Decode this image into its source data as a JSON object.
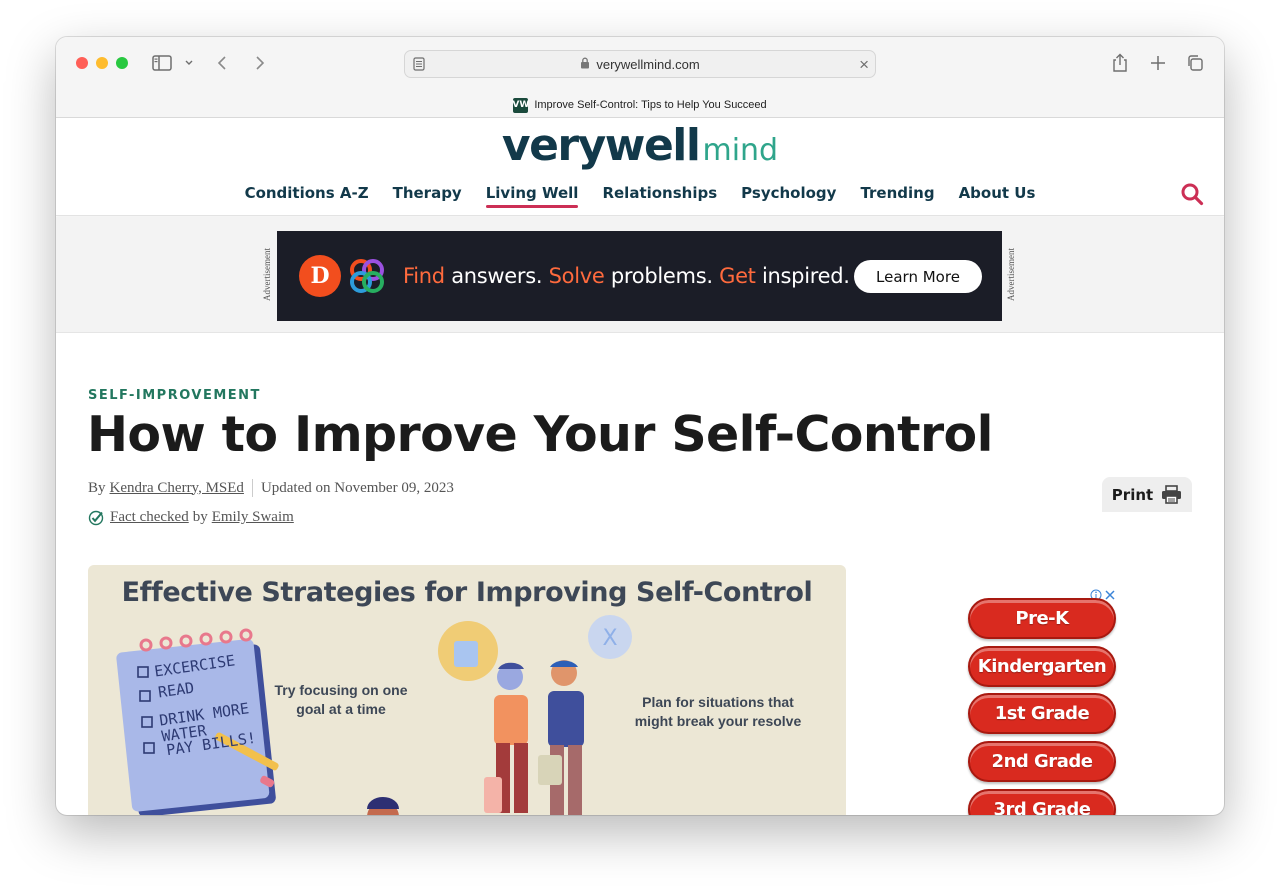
{
  "browser": {
    "url": "verywellmind.com",
    "tab_title": "Improve Self-Control: Tips to Help You Succeed",
    "favicon_text": "VW"
  },
  "site": {
    "logo_primary": "verywell",
    "logo_secondary": "mind",
    "nav": [
      "Conditions A-Z",
      "Therapy",
      "Living Well",
      "Relationships",
      "Psychology",
      "Trending",
      "About Us"
    ],
    "active_nav": "Living Well",
    "accent_color": "#cc2f55",
    "brand_color": "#12394a"
  },
  "ad_banner": {
    "label": "Advertisement",
    "text_parts": [
      "Find",
      " answers. ",
      "Solve",
      " problems. ",
      "Get",
      " inspired."
    ],
    "cta": "Learn More",
    "logo_letter": "D"
  },
  "article": {
    "kicker": "SELF-IMPROVEMENT",
    "title": "How to Improve Your Self-Control",
    "by": "By",
    "author": "Kendra Cherry, MSEd",
    "updated": "Updated on November 09, 2023",
    "fact_checked": "Fact checked",
    "fact_by": "by",
    "fact_checker": "Emily Swaim",
    "print_label": "Print"
  },
  "infographic": {
    "title": "Effective Strategies for Improving Self-Control",
    "checklist": [
      "EXCERCISE",
      "READ",
      "DRINK MORE WATER",
      "PAY BILLS!"
    ],
    "tip1": "Try focusing on one goal at a time",
    "tip2": "Plan for situations that might break your resolve",
    "bubble_mark": "X"
  },
  "side_ad": {
    "grades": [
      "Pre-K",
      "Kindergarten",
      "1st Grade",
      "2nd Grade",
      "3rd Grade"
    ]
  }
}
